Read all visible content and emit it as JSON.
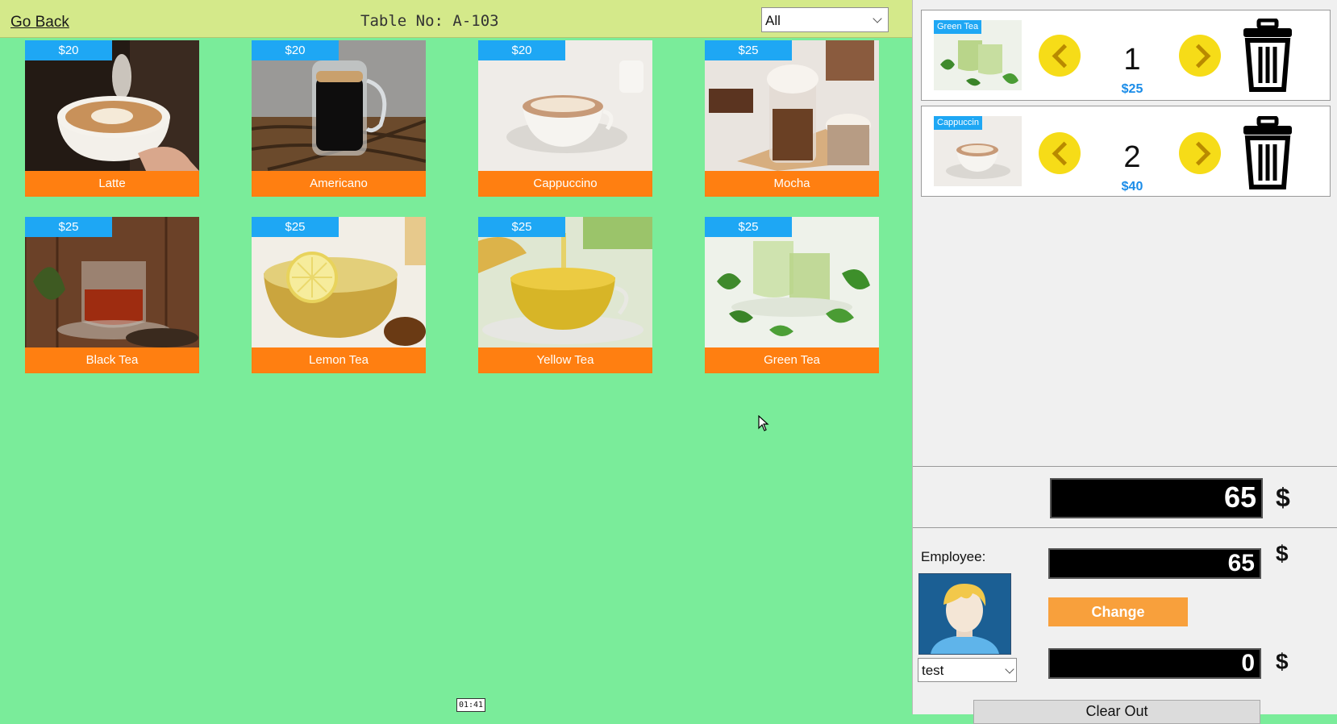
{
  "header": {
    "go_back": "Go Back",
    "table_no": "Table No: A-103",
    "filter_value": "All"
  },
  "products": [
    {
      "name": "Latte",
      "price": "$20"
    },
    {
      "name": "Americano",
      "price": "$20"
    },
    {
      "name": "Cappuccino",
      "price": "$20"
    },
    {
      "name": "Mocha",
      "price": "$25"
    },
    {
      "name": "Black Tea",
      "price": "$25"
    },
    {
      "name": "Lemon Tea",
      "price": "$25"
    },
    {
      "name": "Yellow Tea",
      "price": "$25"
    },
    {
      "name": "Green Tea",
      "price": "$25"
    }
  ],
  "order": {
    "items": [
      {
        "tag": "Green Tea",
        "qty": "1",
        "price": "$25"
      },
      {
        "tag": "Cappuccin",
        "qty": "2",
        "price": "$40"
      }
    ],
    "total": "65",
    "currency": "$"
  },
  "payment": {
    "employee_label": "Employee:",
    "employee_value": "test",
    "paid": "65",
    "change_label": "Change",
    "change_amount": "0",
    "clear_out_label": "Clear Out"
  },
  "overlay": {
    "time": "01:41"
  },
  "colors": {
    "background": "#7aec9a",
    "header_bar": "#d4e98a",
    "price_tag": "#1ea7f4",
    "name_bar": "#ff7f11",
    "arrow_button": "#f6dc18",
    "change_button": "#f8a03c"
  },
  "icons": [
    "chevron-left-icon",
    "chevron-right-icon",
    "trash-icon",
    "dropdown-chevron-icon",
    "user-avatar-icon",
    "mouse-cursor-icon"
  ]
}
